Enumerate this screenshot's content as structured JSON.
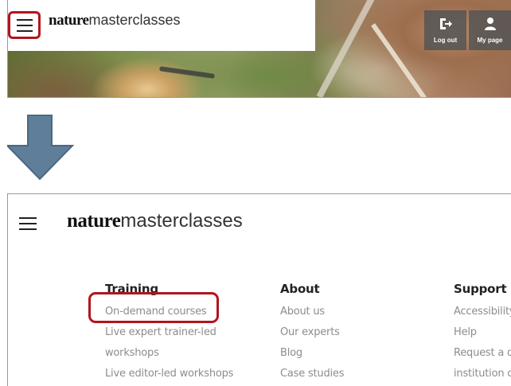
{
  "top_screenshot": {
    "logo": {
      "bold": "nature",
      "light": "masterclasses"
    },
    "user_buttons": [
      {
        "icon": "logout-icon",
        "label": "Log out"
      },
      {
        "icon": "person-icon",
        "label": "My page"
      }
    ]
  },
  "arrow": {
    "icon": "down-arrow-icon",
    "color": "#5e7e99"
  },
  "highlight_color": "#b1151d",
  "bottom_screenshot": {
    "logo": {
      "bold": "nature",
      "light": "masterclasses"
    },
    "columns": {
      "training": {
        "heading": "Training",
        "items": [
          "On-demand courses",
          "Live expert trainer-led",
          "workshops",
          "Live editor-led workshops"
        ]
      },
      "about": {
        "heading": "About",
        "items": [
          "About us",
          "Our experts",
          "Blog",
          "Case studies"
        ]
      },
      "support": {
        "heading": "Support",
        "items": [
          "Accessibility",
          "Help",
          "Request a q",
          "institution c"
        ]
      }
    }
  }
}
